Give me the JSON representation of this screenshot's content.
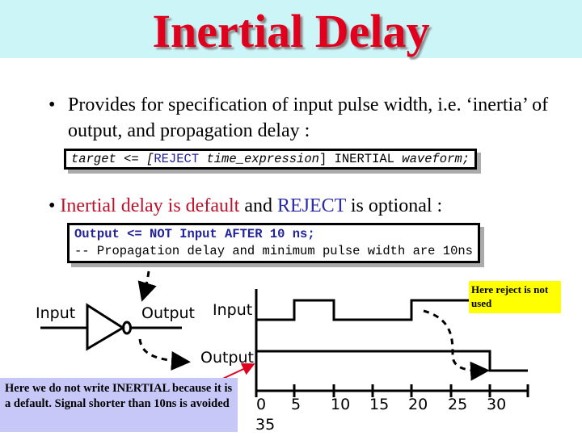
{
  "title": "Inertial Delay",
  "bullet1": {
    "text": "Provides for specification of input pulse width, i.e. ‘inertia’ of output, and propagation delay :"
  },
  "code1": {
    "p1": "target <= [",
    "p2": "REJECT",
    "p3": " time_expression",
    "p4": "] INERTIAL ",
    "p5": "waveform;"
  },
  "bullet2": {
    "red": "Inertial delay is default",
    "mid": " and ",
    "blue": "REJECT",
    "end": " is optional :"
  },
  "code2": {
    "line1": "Output <= NOT Input AFTER 10 ns;",
    "line2": "-- Propagation delay and minimum pulse width are 10ns"
  },
  "gate": {
    "input_label": "Input",
    "output_label": "Output"
  },
  "timing": {
    "input_label": "Input",
    "output_label": "Output",
    "ticks": [
      "0",
      "5",
      "10",
      "15",
      "20",
      "25",
      "30"
    ],
    "extra_tick": "35"
  },
  "notes": {
    "yellow": "Here reject is not used",
    "blue": "Here we do not write INERTIAL because it is a default. Signal shorter than 10ns is avoided"
  },
  "colors": {
    "title": "#e0001e",
    "band": "#ccf5f8",
    "yellow_note": "#ffff00",
    "blue_note": "#c8c8f8",
    "arrow": "#e00020"
  }
}
